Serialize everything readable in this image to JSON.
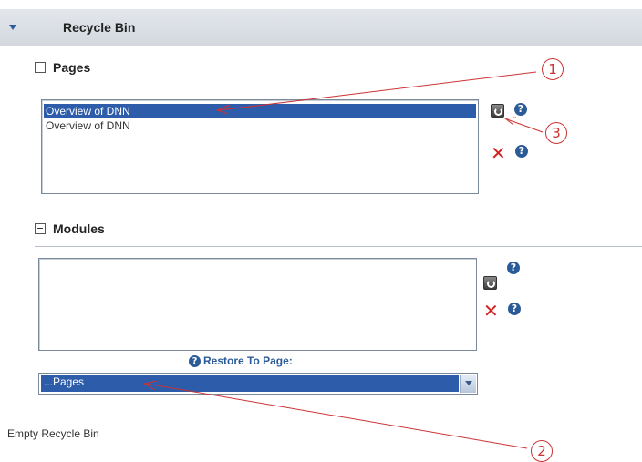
{
  "panel": {
    "title": "Recycle Bin"
  },
  "pages": {
    "section_title": "Pages",
    "items": [
      "Overview of DNN",
      "Overview of DNN"
    ]
  },
  "modules": {
    "section_title": "Modules",
    "items": []
  },
  "restore_to_page": {
    "label": "Restore To Page:",
    "selected": "...Pages"
  },
  "actions": {
    "empty_recycle_bin": "Empty Recycle Bin"
  },
  "icons": {
    "restore": "restore-icon",
    "help": "help-icon",
    "delete": "delete-x-icon",
    "collapse": "minus-box-icon",
    "expand_triangle": "triangle-down-icon"
  },
  "annotations": [
    "1",
    "2",
    "3"
  ],
  "colors": {
    "selection": "#2c5caa",
    "help_blue": "#2b5b97",
    "delete_red": "#d22020",
    "annotation_red": "#c33333"
  }
}
